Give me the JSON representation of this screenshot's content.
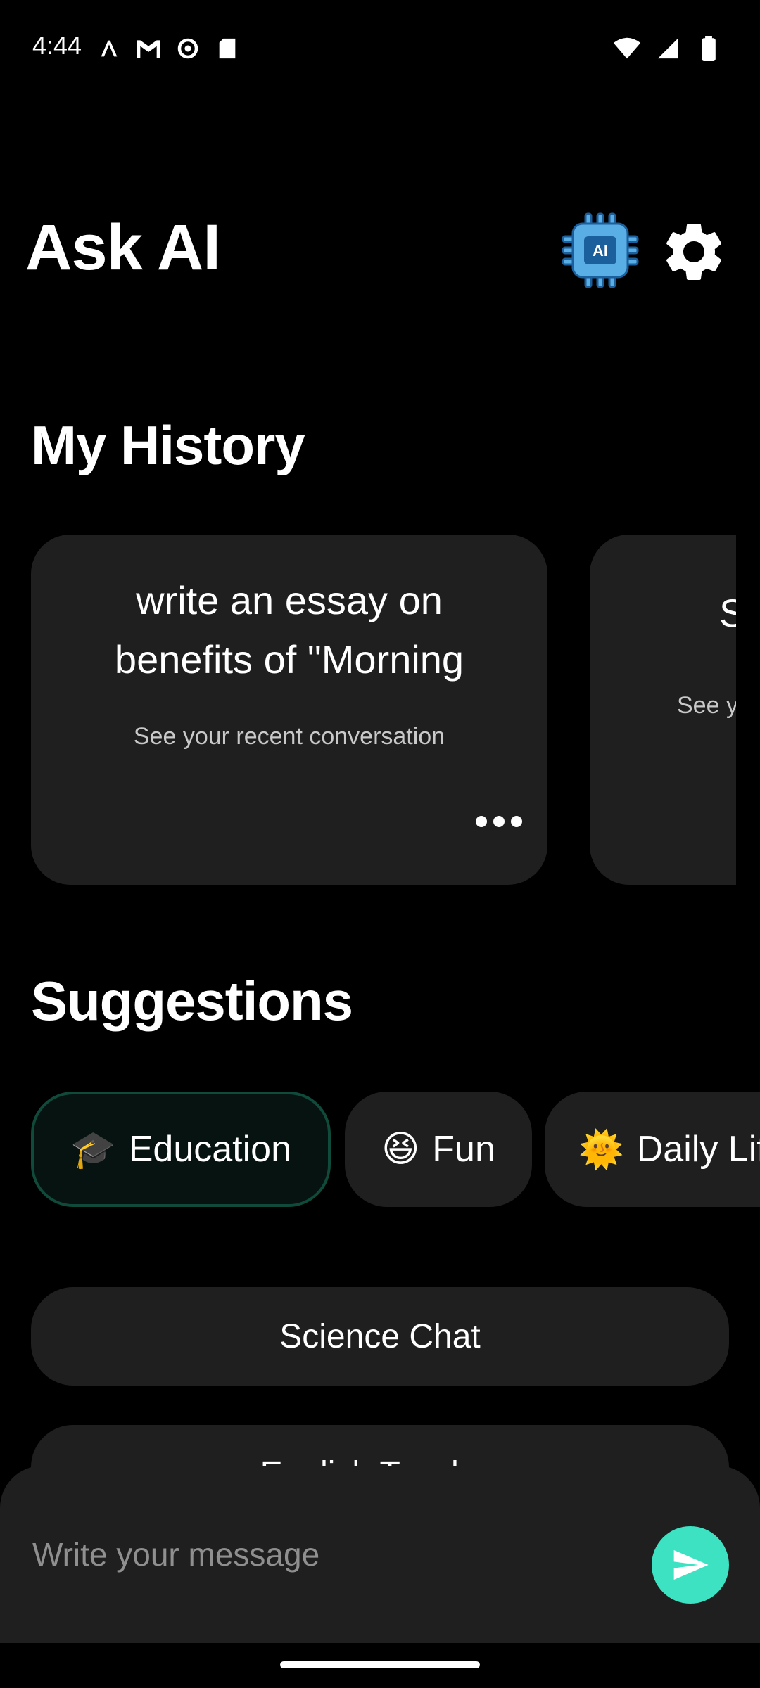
{
  "status": {
    "time": "4:44",
    "left_icons": [
      "text-icon",
      "gmail-icon",
      "gear-status-icon",
      "sdcard-icon"
    ],
    "right_icons": [
      "wifi-icon",
      "signal-icon",
      "battery-icon"
    ]
  },
  "header": {
    "title": "Ask AI",
    "chip_icon_text": "AI",
    "settings_icon": "settings-icon"
  },
  "history": {
    "title": "My History",
    "cards": [
      {
        "text": "write an essay on benefits of  \"Morning",
        "subtitle": "See your recent conversation"
      },
      {
        "text": "S",
        "subtitle": "See y"
      }
    ]
  },
  "suggestions": {
    "title": "Suggestions",
    "chips": [
      {
        "emoji": "🎓",
        "label": "Education",
        "active": true
      },
      {
        "emoji": "😆",
        "label": "Fun",
        "active": false
      },
      {
        "emoji": "🌞",
        "label": "Daily Lif",
        "active": false
      }
    ],
    "items": [
      {
        "label": "Science Chat"
      },
      {
        "label": "English Teacher"
      }
    ]
  },
  "composer": {
    "placeholder": "Write your message",
    "send_color": "#3de2c3"
  },
  "colors": {
    "background": "#000000",
    "card": "#1f1f1f",
    "accent": "#3de2c3"
  }
}
